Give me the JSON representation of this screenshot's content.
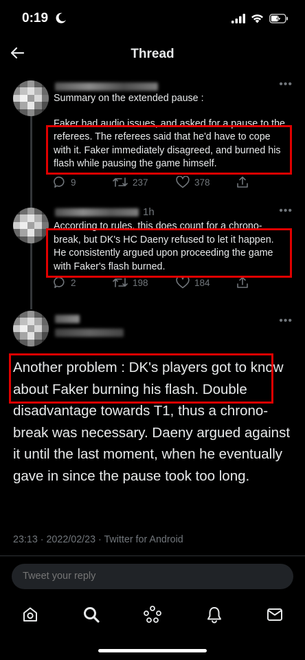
{
  "status_bar": {
    "time": "0:19"
  },
  "header": {
    "title": "Thread"
  },
  "tweets": [
    {
      "paragraphs": [
        "Summary on the extended pause :",
        "Faker had audio issues, and asked for a pause to the referees. The referees said that he'd have to cope with it. Faker immediately disagreed, and burned his flash while pausing the game himself."
      ],
      "reply_count": "9",
      "retweet_count": "237",
      "like_count": "378"
    },
    {
      "time": "1h",
      "paragraphs": [
        "According to rules, this does count for a chrono-break, but DK's HC Daeny refused to let it happen. He consistently argued upon proceeding the game with Faker's flash burned."
      ],
      "reply_count": "2",
      "retweet_count": "198",
      "like_count": "184"
    }
  ],
  "main_tweet": {
    "text": "Another problem : DK's players got to know about Faker burning his flash. Double disadvantage towards T1, thus a chrono-break was necessary. Daeny argued against it until the last moment, when he eventually gave in since the pause took too long.",
    "meta": "23:13 · 2022/02/23 · Twitter for Android"
  },
  "reply": {
    "placeholder": "Tweet your reply"
  },
  "nav": [
    "home-icon",
    "search-icon",
    "spaces-icon",
    "notifications-icon",
    "messages-icon"
  ],
  "colors": {
    "background": "#000000",
    "text": "#e7e9ea",
    "muted": "#71767b",
    "highlight": "#e00000",
    "reply_box": "#202327"
  }
}
